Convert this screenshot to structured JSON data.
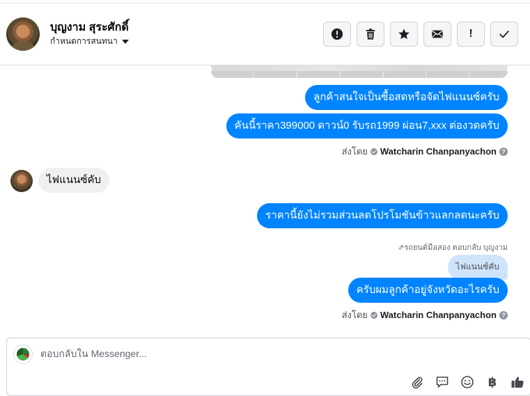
{
  "header": {
    "contact_name": "บุญงาม สุระศักดิ์",
    "subtitle": "กำหนดการสนทนา",
    "actions": [
      {
        "name": "mark-spam-button",
        "icon": "alert-circle-icon"
      },
      {
        "name": "delete-button",
        "icon": "trash-icon"
      },
      {
        "name": "star-button",
        "icon": "star-icon"
      },
      {
        "name": "mark-unread-button",
        "icon": "envelope-icon",
        "glyph": ""
      },
      {
        "name": "follow-up-button",
        "icon": "exclamation-icon",
        "glyph": "!"
      },
      {
        "name": "mark-done-button",
        "icon": "checkmark-icon"
      }
    ]
  },
  "thread": {
    "messages_out_1": [
      "ลูกค้าสนใจเป็นซื้อสดหรือจัดไฟแนนซ์ครับ",
      "คันนี้ราคา399000 ดาวน์0   รับรถ1999 ผ่อน7,xxx ต่องวดครับ"
    ],
    "sent_by_label": "ส่งโดย",
    "sender_name": "Watcharin Chanpanyachon",
    "incoming_1": "ไฟแนนซ์คับ",
    "messages_out_2": "ราคานี้ยังไม่รวมส่วนลดโปรโมชันข้าวแลกลดนะครับ",
    "reply_meta": "รถยนต์มือสอง ตอบกลับ บุญงาม",
    "quoted_text": "ไฟแนนซ์คับ",
    "messages_out_3": "ครับผมลูกค้าอยู่จังหวัดอะไรครับ"
  },
  "composer": {
    "placeholder": "ตอบกลับใน Messenger...",
    "tools": [
      "paperclip-icon",
      "chat-bubble-icon",
      "smiley-icon",
      "baht-icon",
      "thumbs-up-icon"
    ],
    "baht_glyph": "฿"
  },
  "colors": {
    "outgoing_bubble": "#0084ff",
    "incoming_bubble": "#f0f0f0",
    "quoted_bubble": "#cfe4fb"
  }
}
